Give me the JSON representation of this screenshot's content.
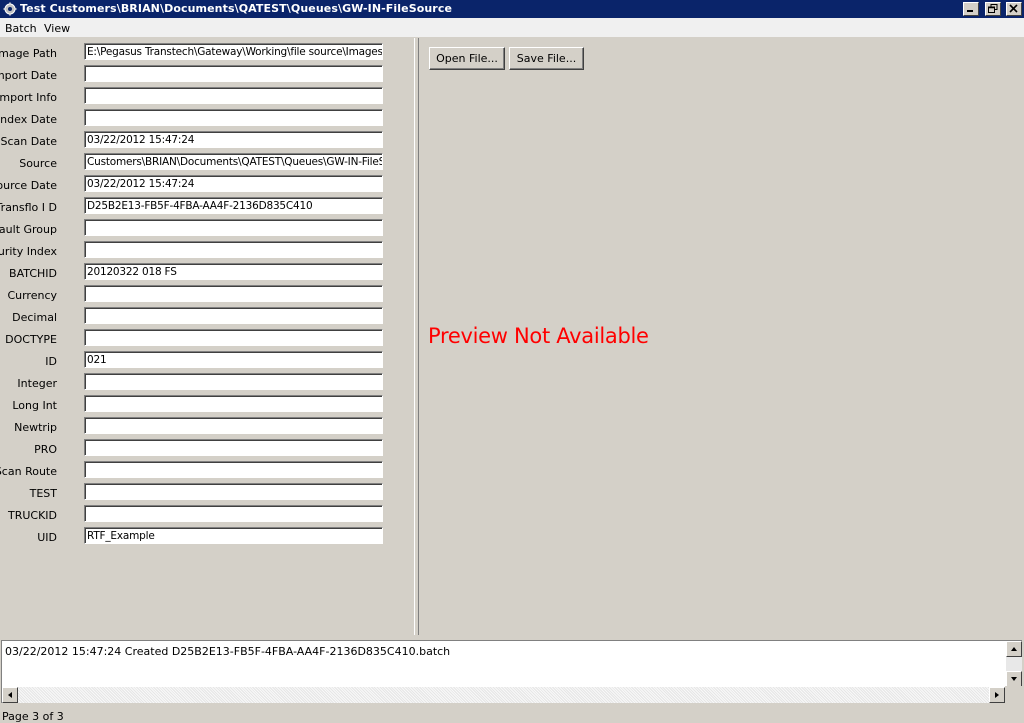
{
  "window": {
    "title": "Test Customers\\BRIAN\\Documents\\QATEST\\Queues\\GW-IN-FileSource",
    "icon": "gear-icon"
  },
  "menu": {
    "items": [
      {
        "label": "Batch"
      },
      {
        "label": "View"
      }
    ]
  },
  "fields": [
    {
      "label": "Image  Path",
      "value": "E:\\Pegasus Transtech\\Gateway\\Working\\file source\\Images\\"
    },
    {
      "label": "Import  Date",
      "value": ""
    },
    {
      "label": "Import  Info",
      "value": ""
    },
    {
      "label": "Index  Date",
      "value": ""
    },
    {
      "label": "Scan  Date",
      "value": "03/22/2012 15:47:24"
    },
    {
      "label": "Source",
      "value": "Customers\\BRIAN\\Documents\\QATEST\\Queues\\GW-IN-FileS"
    },
    {
      "label": "Source  Date",
      "value": "03/22/2012 15:47:24"
    },
    {
      "label": "Transflo  I D",
      "value": "D25B2E13-FB5F-4FBA-AA4F-2136D835C410"
    },
    {
      "label": "Default  Group",
      "value": ""
    },
    {
      "label": "Security  Index",
      "value": ""
    },
    {
      "label": "BATCHID",
      "value": "20120322 018 FS"
    },
    {
      "label": "Currency",
      "value": ""
    },
    {
      "label": "Decimal",
      "value": ""
    },
    {
      "label": "DOCTYPE",
      "value": ""
    },
    {
      "label": "ID",
      "value": "021"
    },
    {
      "label": "Integer",
      "value": ""
    },
    {
      "label": "Long Int",
      "value": ""
    },
    {
      "label": "Newtrip",
      "value": ""
    },
    {
      "label": "PRO",
      "value": ""
    },
    {
      "label": "Scan Route",
      "value": ""
    },
    {
      "label": "TEST",
      "value": ""
    },
    {
      "label": "TRUCKID",
      "value": ""
    },
    {
      "label": "UID",
      "value": "RTF_Example"
    }
  ],
  "buttons": {
    "open_file": "Open File...",
    "save_file": "Save File..."
  },
  "preview": {
    "message": "Preview Not Available",
    "color": "#ff0000"
  },
  "log": {
    "lines": [
      "03/22/2012 15:47:24 Created D25B2E13-FB5F-4FBA-AA4F-2136D835C410.batch"
    ]
  },
  "status": {
    "text": "Page 3 of 3"
  }
}
